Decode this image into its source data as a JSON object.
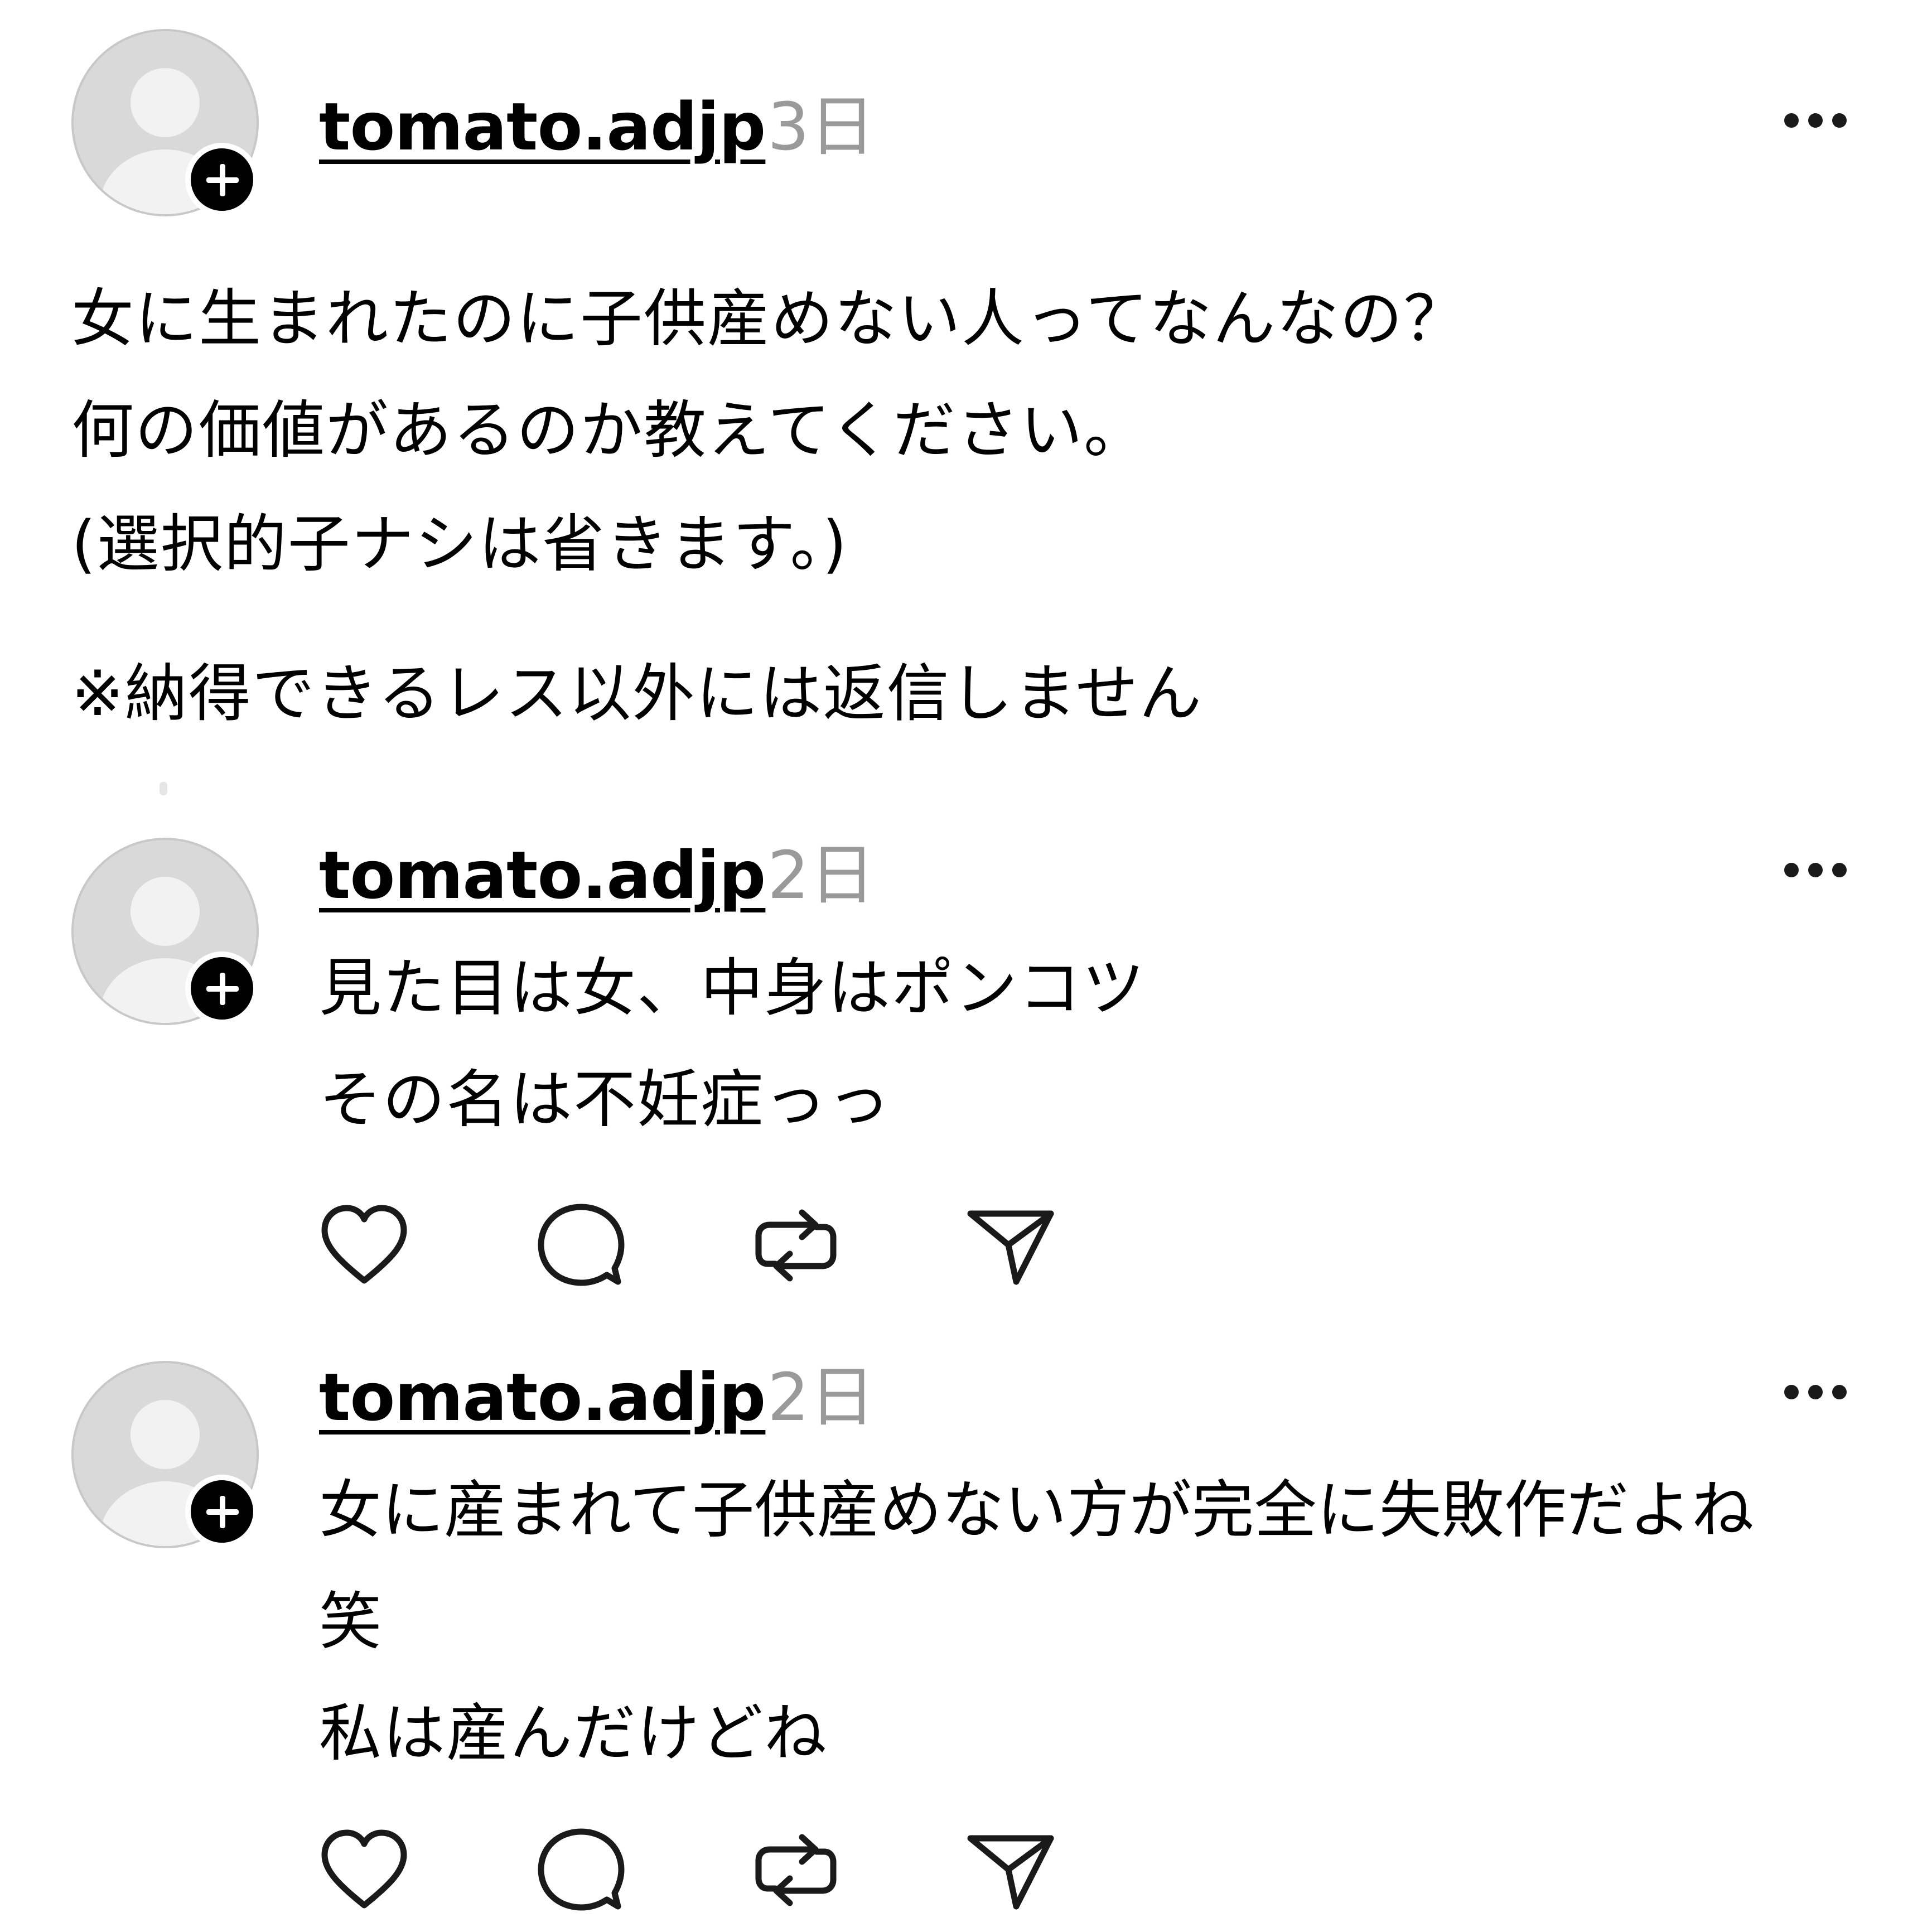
{
  "posts": [
    {
      "username": "tomato.adjp",
      "time": "3日",
      "lines": [
        "女に生まれたのに子供産めない人ってなんなの？",
        "何の価値があるのか教えてください。",
        "(選択的子ナシは省きます。)",
        "※納得できるレス以外には返信しません"
      ]
    },
    {
      "username": "tomato.adjp",
      "time": "2日",
      "lines": [
        "見た目は女、中身はポンコツ",
        "その名は不妊症っっ"
      ]
    },
    {
      "username": "tomato.adjp",
      "time": "2日",
      "lines": [
        "女に産まれて子供産めない方が完全に失敗作だよね",
        "笑",
        "私は産んだけどね"
      ]
    }
  ],
  "icons": {
    "avatar": "default-avatar-icon",
    "follow": "plus-icon",
    "more": "ellipsis-icon",
    "like": "heart-icon",
    "reply": "comment-bubble-icon",
    "repost": "repost-arrows-icon",
    "share": "paper-plane-icon"
  },
  "colors": {
    "text": "#000000",
    "muted": "#9a9a9a",
    "avatar_bg": "#d9d9d9",
    "badge": "#000000"
  }
}
